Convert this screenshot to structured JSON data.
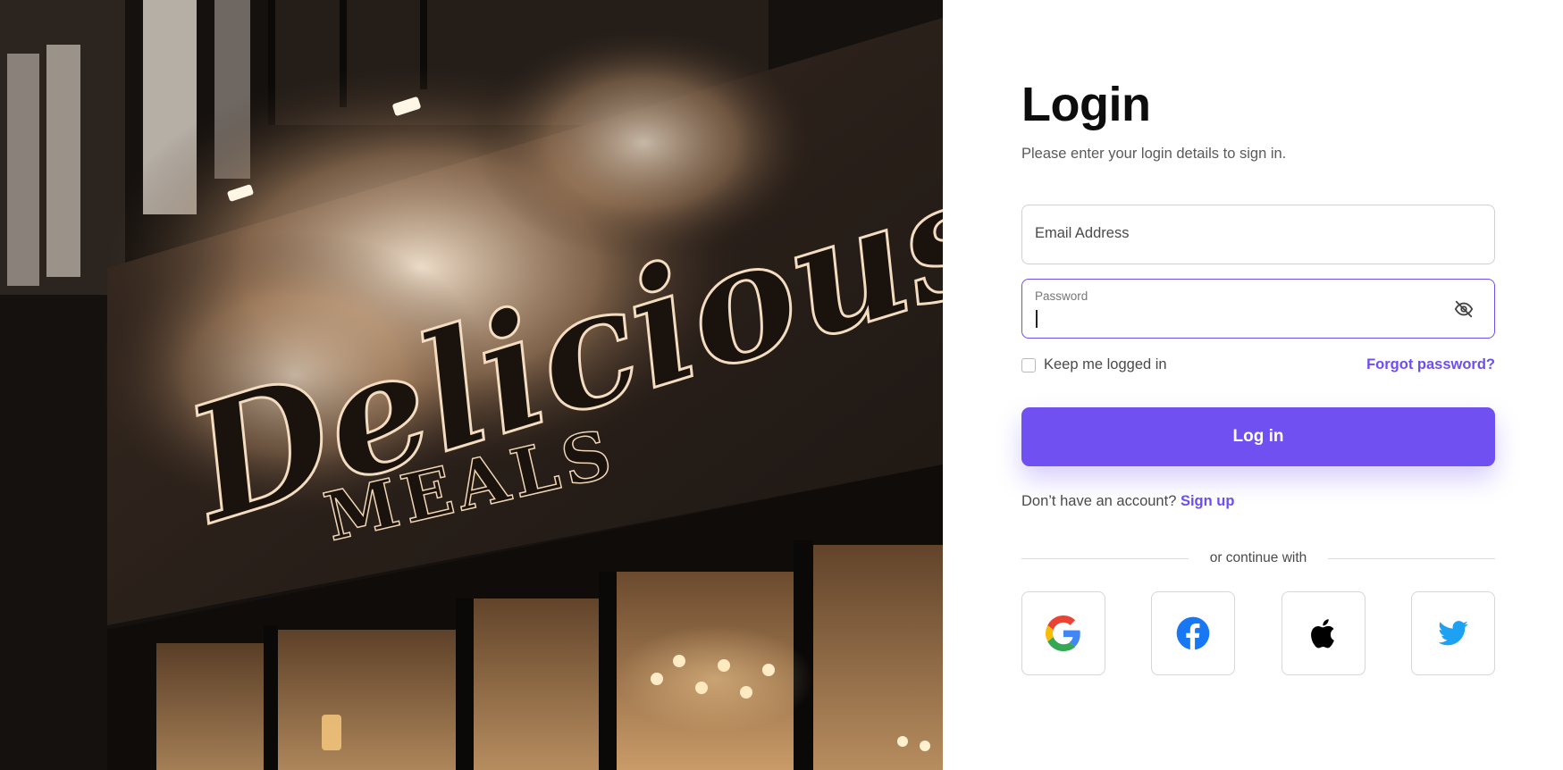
{
  "hero": {
    "sign_line1": "Delicious",
    "sign_line2": "MEALS"
  },
  "login": {
    "title": "Login",
    "subtitle": "Please enter your login details to sign in.",
    "email_placeholder": "Email Address",
    "password_label": "Password",
    "password_value": "",
    "remember_label": "Keep me logged in",
    "forgot_label": "Forgot password?",
    "submit_label": "Log in",
    "signup_prompt": "Don’t have an account?",
    "signup_link": "Sign up",
    "divider_text": "or continue with"
  },
  "social": [
    {
      "icon": "google-icon"
    },
    {
      "icon": "facebook-icon"
    },
    {
      "icon": "apple-icon"
    },
    {
      "icon": "twitter-icon"
    }
  ],
  "colors": {
    "accent": "#7050f0",
    "link": "#6c4ef2",
    "google_blue": "#4285F4",
    "google_red": "#EA4335",
    "google_yellow": "#FBBC05",
    "google_green": "#34A853",
    "facebook": "#1877F2",
    "twitter": "#1DA1F2"
  }
}
